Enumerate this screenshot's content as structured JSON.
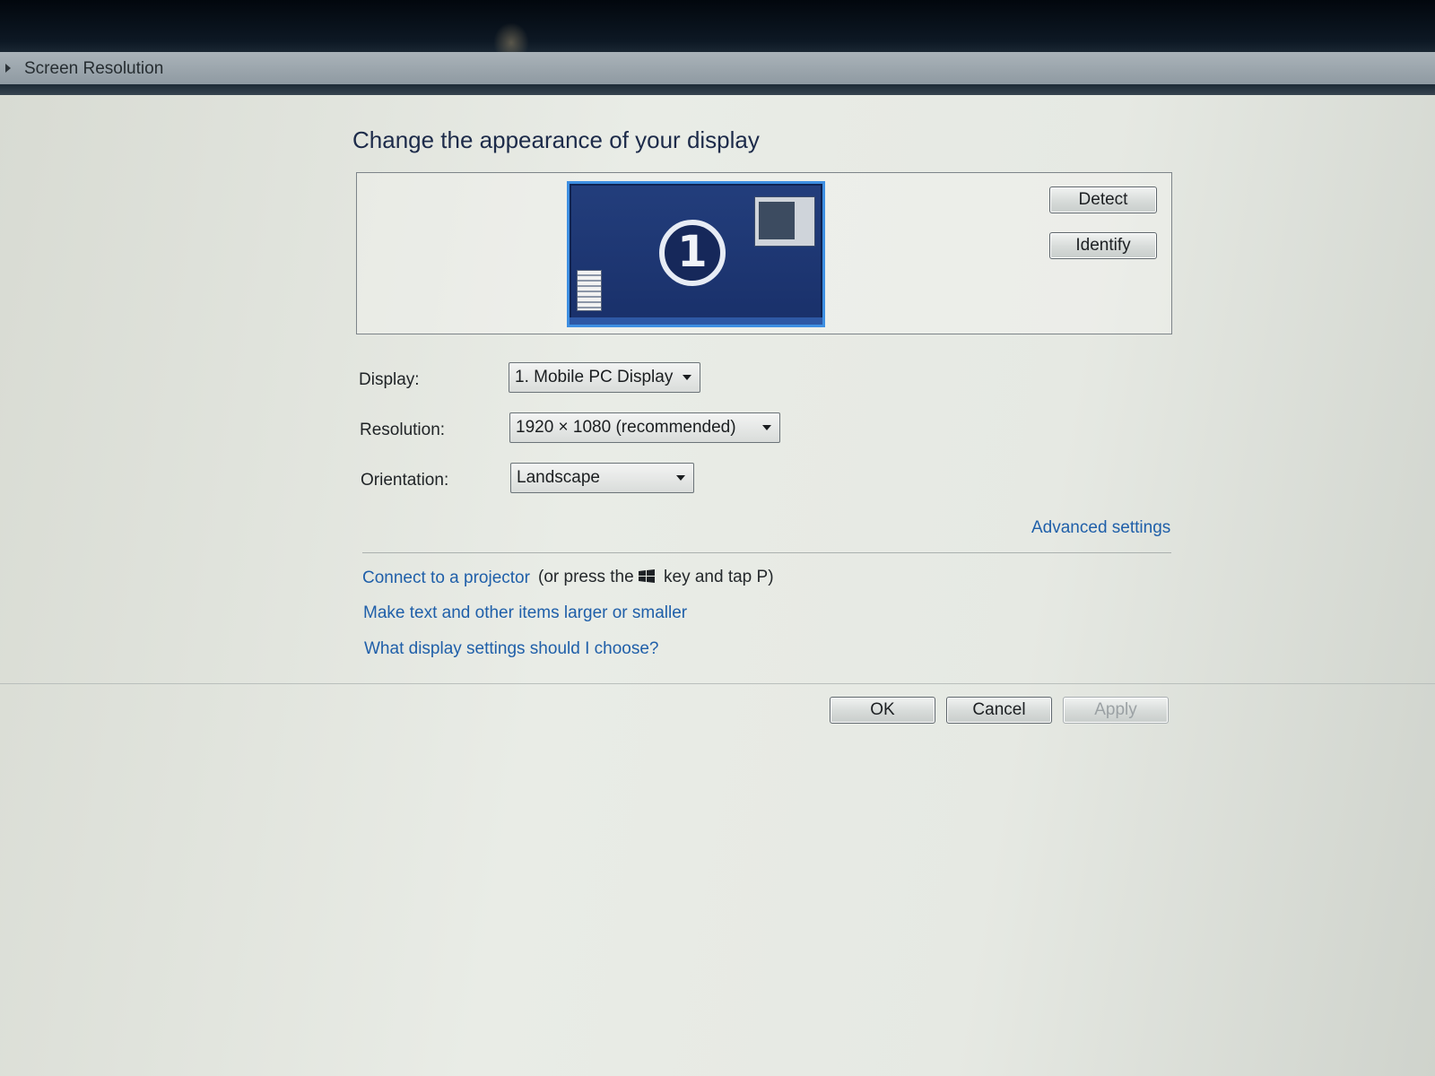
{
  "window": {
    "title": "Screen Resolution"
  },
  "main": {
    "heading": "Change the appearance of your display",
    "monitor_number": "1",
    "detect_label": "Detect",
    "identify_label": "Identify",
    "display_label": "Display:",
    "display_value": "1. Mobile PC Display",
    "resolution_label": "Resolution:",
    "resolution_value": "1920 × 1080 (recommended)",
    "orientation_label": "Orientation:",
    "orientation_value": "Landscape",
    "advanced_link": "Advanced settings"
  },
  "links": {
    "projector_link": "Connect to a projector",
    "projector_text_before": "(or press the",
    "projector_text_after": "key and tap P)",
    "text_size_link": "Make text and other items larger or smaller",
    "help_link": "What display settings should I choose?"
  },
  "footer": {
    "ok_label": "OK",
    "cancel_label": "Cancel",
    "apply_label": "Apply"
  }
}
